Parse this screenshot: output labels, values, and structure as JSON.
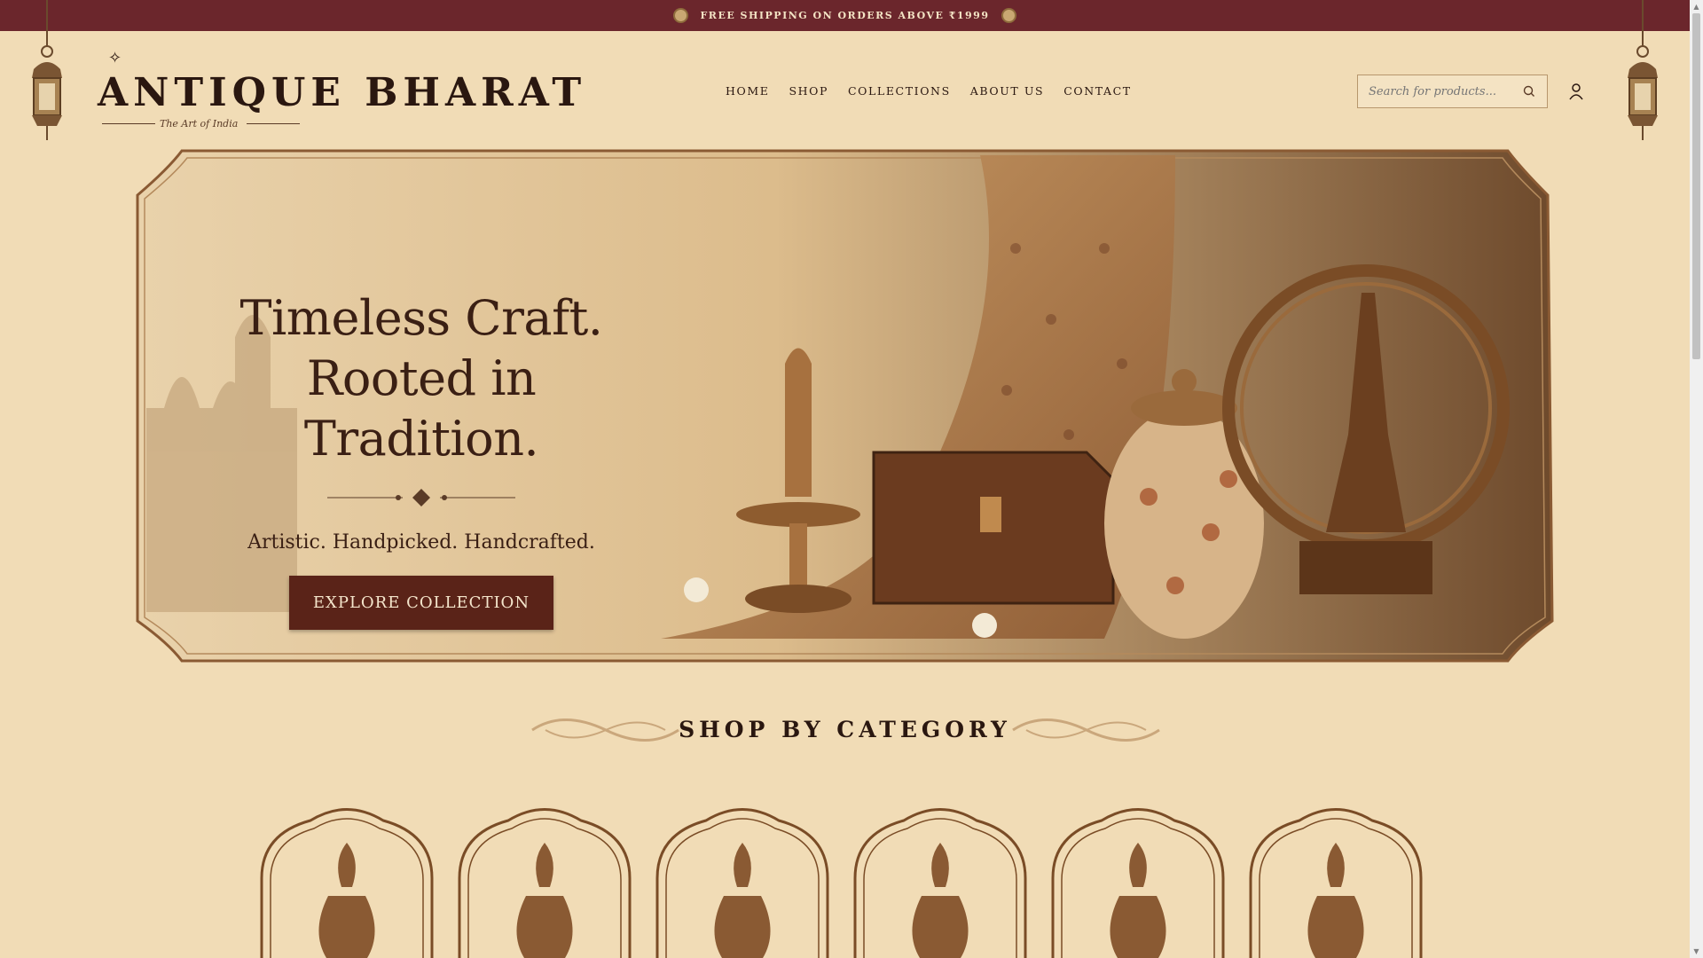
{
  "announcement": {
    "text": "FREE SHIPPING ON ORDERS ABOVE ₹1999"
  },
  "brand": {
    "name": "ANTIQUE BHARAT",
    "tagline": "The Art of India"
  },
  "nav": {
    "items": [
      {
        "label": "HOME"
      },
      {
        "label": "SHOP"
      },
      {
        "label": "COLLECTIONS"
      },
      {
        "label": "ABOUT US"
      },
      {
        "label": "CONTACT"
      }
    ]
  },
  "search": {
    "placeholder": "Search for products..."
  },
  "hero": {
    "title_line1": "Timeless Craft.",
    "title_line2": "Rooted in Tradition.",
    "subtitle": "Artistic. Handpicked. Handcrafted.",
    "cta_label": "EXPLORE COLLECTION"
  },
  "categories": {
    "heading": "SHOP BY CATEGORY",
    "count": 6
  },
  "colors": {
    "bar": "#6b262c",
    "background": "#f1dcb6",
    "accent_dark": "#5a2318",
    "ink": "#2a1710",
    "bronze": "#8a5a33"
  }
}
